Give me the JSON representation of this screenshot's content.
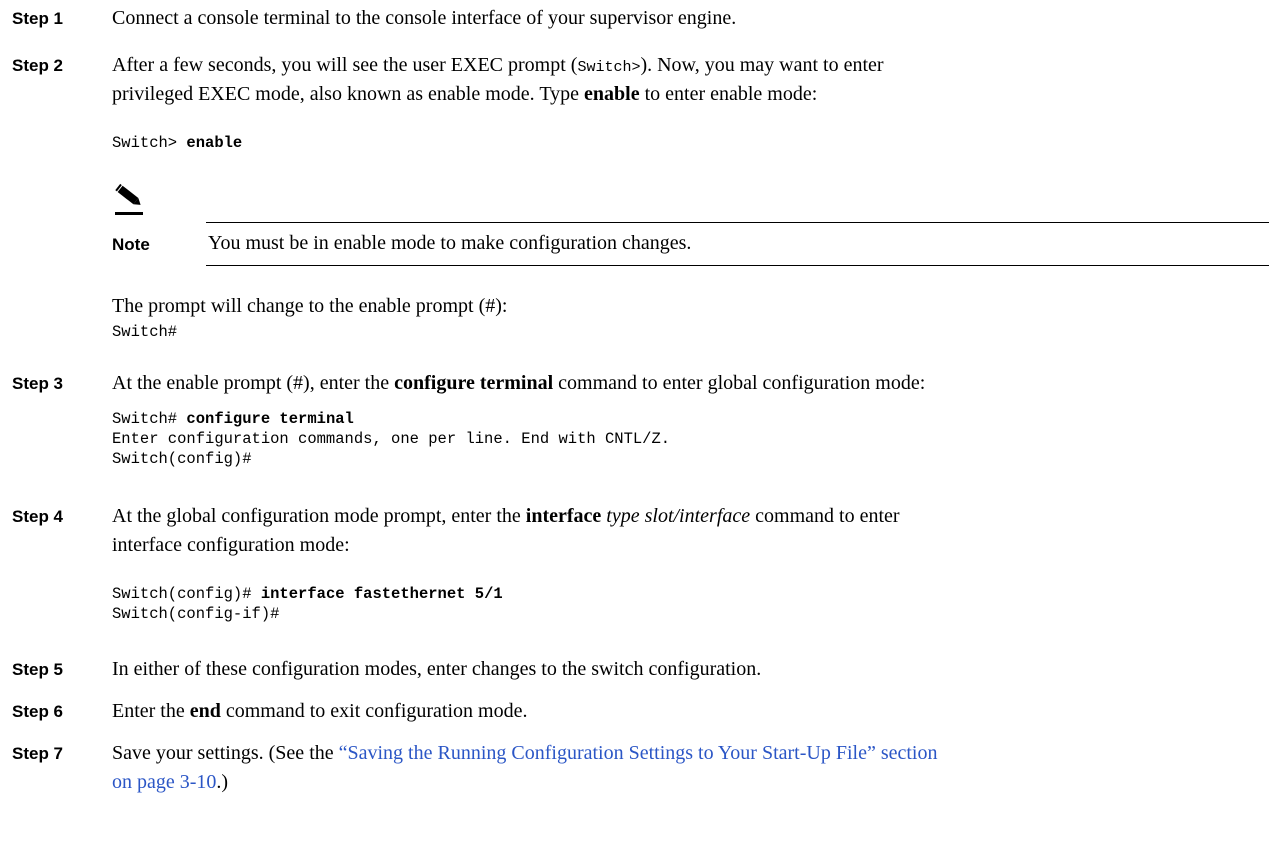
{
  "steps": [
    {
      "label": "Step 1",
      "text": "Connect a console terminal to the console interface of your supervisor engine."
    },
    {
      "label": "Step 2",
      "line1_a": "After a few seconds, you will see the user EXEC prompt (",
      "line1_code": "Switch>",
      "line1_b": "). Now, you may want to enter",
      "line2_a": "privileged EXEC mode, also known as enable mode. Type ",
      "line2_bold": "enable",
      "line2_b": " to enter enable mode:",
      "code_prompt": "Switch> ",
      "code_cmd": "enable",
      "note_label": "Note",
      "note_text": "You must be in enable mode to make configuration changes.",
      "after_text": "The prompt will change to the enable prompt (#):",
      "after_code": "Switch#"
    },
    {
      "label": "Step 3",
      "text_a": "At the enable prompt (#), enter the ",
      "text_bold": "configure terminal",
      "text_b": " command to enter global configuration mode:",
      "code1_prompt": "Switch# ",
      "code1_cmd": "configure terminal",
      "code2": "Enter configuration commands, one per line. End with CNTL/Z.",
      "code3": "Switch(config)#"
    },
    {
      "label": "Step 4",
      "line1_a": "At the global configuration mode prompt, enter the ",
      "line1_bold": "interface",
      "line1_italic": "type slot/interface",
      "line1_b": " command to enter",
      "line2": "interface configuration mode:",
      "code1_prompt": "Switch(config)# ",
      "code1_cmd": "interface fastethernet 5/1",
      "code2": "Switch(config-if)#"
    },
    {
      "label": "Step 5",
      "text": "In either of these configuration modes, enter changes to the switch configuration."
    },
    {
      "label": "Step 6",
      "text_a": "Enter the ",
      "text_bold": "end",
      "text_b": " command to exit configuration mode."
    },
    {
      "label": "Step 7",
      "text_a": "Save your settings. (See the ",
      "link1": "“Saving the Running Configuration Settings to Your Start-Up File” section",
      "link2": "on page 3-10",
      "text_b": ".)"
    }
  ]
}
